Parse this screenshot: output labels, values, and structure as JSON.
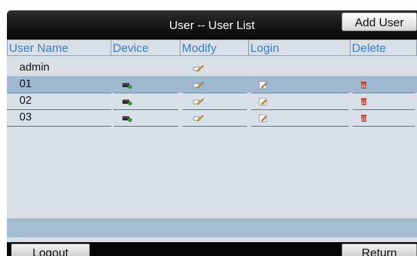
{
  "header": {
    "title": "User -- User List",
    "add_user_label": "Add User"
  },
  "table": {
    "columns": [
      "User Name",
      "Device",
      "Modify",
      "Login",
      "Delete"
    ],
    "rows": [
      {
        "name": "admin",
        "selected": false,
        "icons": {
          "device": false,
          "modify": true,
          "login": false,
          "delete": false
        }
      },
      {
        "name": "01",
        "selected": true,
        "icons": {
          "device": true,
          "modify": true,
          "login": true,
          "delete": true
        }
      },
      {
        "name": "02",
        "selected": false,
        "icons": {
          "device": true,
          "modify": true,
          "login": true,
          "delete": true
        }
      },
      {
        "name": "03",
        "selected": false,
        "icons": {
          "device": true,
          "modify": true,
          "login": true,
          "delete": true
        }
      }
    ],
    "icon_names": {
      "device": "device-icon",
      "modify": "modify-icon",
      "login": "login-edit-icon",
      "delete": "trash-icon"
    }
  },
  "footer": {
    "logout_label": "Logout",
    "return_label": "Return"
  },
  "colors": {
    "header_text": "#3d7dc0",
    "selected_row": "#9fb8cf",
    "panel": "#d8dfe6",
    "trash": "#d0321f",
    "device_green": "#2e9a39"
  }
}
